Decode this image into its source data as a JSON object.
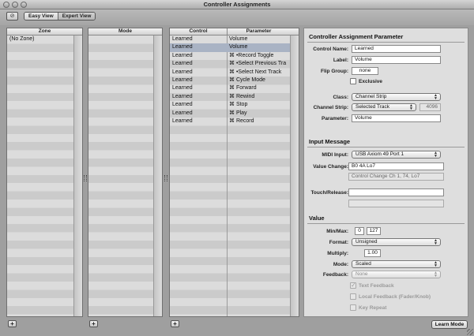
{
  "window": {
    "title": "Controller Assignments"
  },
  "toolbar": {
    "link_icon_glyph": "⊘",
    "view_tabs": [
      {
        "label": "Easy View"
      },
      {
        "label": "Expert View"
      }
    ]
  },
  "zone_pane": {
    "header": "Zone",
    "rows": [
      "(No Zone)"
    ]
  },
  "mode_pane": {
    "header": "Mode",
    "rows": []
  },
  "control_pane": {
    "headers": {
      "control": "Control",
      "parameter": "Parameter"
    },
    "rows": [
      {
        "control": "Learned",
        "parameter": "Volume",
        "selected": false
      },
      {
        "control": "Learned",
        "parameter": "Volume",
        "selected": true
      },
      {
        "control": "Learned",
        "parameter": "⌘ •Record Toggle",
        "selected": false
      },
      {
        "control": "Learned",
        "parameter": "⌘ •Select Previous Tra",
        "selected": false
      },
      {
        "control": "Learned",
        "parameter": "⌘ •Select Next Track",
        "selected": false
      },
      {
        "control": "Learned",
        "parameter": "⌘ Cycle Mode",
        "selected": false
      },
      {
        "control": "Learned",
        "parameter": "⌘ Forward",
        "selected": false
      },
      {
        "control": "Learned",
        "parameter": "⌘ Rewind",
        "selected": false
      },
      {
        "control": "Learned",
        "parameter": "⌘ Stop",
        "selected": false
      },
      {
        "control": "Learned",
        "parameter": "⌘ Play",
        "selected": false
      },
      {
        "control": "Learned",
        "parameter": "⌘ Record",
        "selected": false
      }
    ]
  },
  "add_button_label": "+",
  "inspector": {
    "assignment": {
      "title": "Controller Assignment Parameter",
      "control_name_label": "Control Name:",
      "control_name_value": "Learned",
      "label_label": "Label:",
      "label_value": "Volume",
      "flip_group_label": "Flip Group:",
      "flip_group_value": "none",
      "exclusive_label": "Exclusive",
      "class_label": "Class:",
      "class_value": "Channel Strip",
      "channel_strip_label": "Channel Strip:",
      "channel_strip_value": "Selected Track",
      "channel_strip_number": "4096",
      "parameter_label": "Parameter:",
      "parameter_value": "Volume"
    },
    "input_message": {
      "title": "Input Message",
      "midi_input_label": "MIDI Input:",
      "midi_input_value": "USB Axiom 49 Port 1",
      "value_change_label": "Value Change:",
      "value_change_value": "B0 4A Lo7",
      "value_change_description": "Control Change Ch 1, 74, Lo7",
      "touch_release_label": "Touch/Release:",
      "touch_release_value": ""
    },
    "value": {
      "title": "Value",
      "min_max_label": "Min/Max:",
      "min_value": "0",
      "max_value": "127",
      "format_label": "Format:",
      "format_value": "Unsigned",
      "multiply_label": "Multiply:",
      "multiply_value": "1.00",
      "mode_label": "Mode:",
      "mode_value": "Scaled",
      "feedback_label": "Feedback:",
      "feedback_value": "None",
      "text_feedback_label": "Text Feedback",
      "local_feedback_label": "Local Feedback (Fader/Knob)",
      "key_repeat_label": "Key Repeat"
    }
  },
  "learn_mode_label": "Learn Mode"
}
